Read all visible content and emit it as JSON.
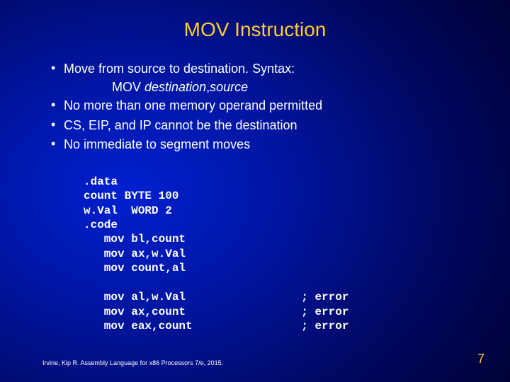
{
  "title": "MOV Instruction",
  "bullets": {
    "b1": "Move from source to destination. Syntax:",
    "syntax_prefix": "MOV ",
    "syntax_dest": "destination",
    "syntax_sep": ",",
    "syntax_src": "source",
    "b2": "No more than one memory operand permitted",
    "b3": "CS, EIP, and IP cannot be the destination",
    "b4": "No immediate to segment moves"
  },
  "code": ".data\ncount BYTE 100\nw.Val  WORD 2\n.code\n   mov bl,count\n   mov ax,w.Val\n   mov count,al\n\n   mov al,w.Val                 ; error\n   mov ax,count                 ; error\n   mov eax,count                ; error",
  "footer": "Irvine, Kip R. Assembly Language for x86 Processors 7/e, 2015.",
  "page_number": "7"
}
